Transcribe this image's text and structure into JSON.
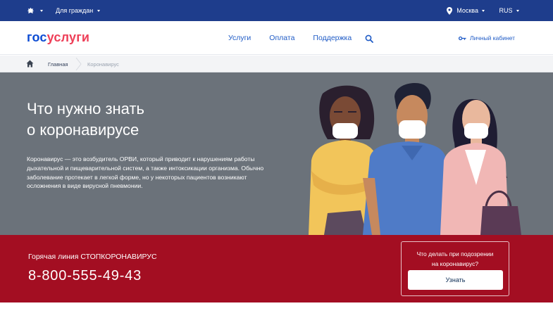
{
  "topbar": {
    "audience": "Для граждан",
    "city": "Москва",
    "language": "RUS"
  },
  "header": {
    "logo_part1": "гос",
    "logo_part2": "услуги",
    "nav": [
      {
        "label": "Услуги"
      },
      {
        "label": "Оплата"
      },
      {
        "label": "Поддержка"
      }
    ],
    "cabinet_label": "Личный кабинет"
  },
  "breadcrumb": {
    "home": "Главная",
    "current": "Коронавирус"
  },
  "hero": {
    "title_line1": "Что нужно знать",
    "title_line2": "о коронавирусе",
    "text": "Коронавирус — это возбудитель ОРВИ, который приводит к нарушениям работы дыхательной и пищеварительной систем, а также интоксикации организма. Обычно заболевание протекает в легкой форме, но у некоторых пациентов возникают осложнения в виде вирусной пневмонии."
  },
  "hotline": {
    "label": "Горячая линия СТОПКОРОНАВИРУС",
    "phone": "8-800-555-49-43",
    "question_line1": "Что делать при подозрении",
    "question_line2": "на коронавирус?",
    "button_label": "Узнать"
  },
  "colors": {
    "topbar": "#1e3d8c",
    "hero_bg": "#6b727a",
    "band": "#a30e22",
    "link": "#1f5bc6",
    "logo_blue": "#0d4cd3",
    "logo_red": "#ee3f58"
  },
  "icons": {
    "emblem": "coat-of-arms-icon",
    "location": "map-pin-icon",
    "search": "search-icon",
    "key": "key-icon",
    "home": "home-icon"
  }
}
